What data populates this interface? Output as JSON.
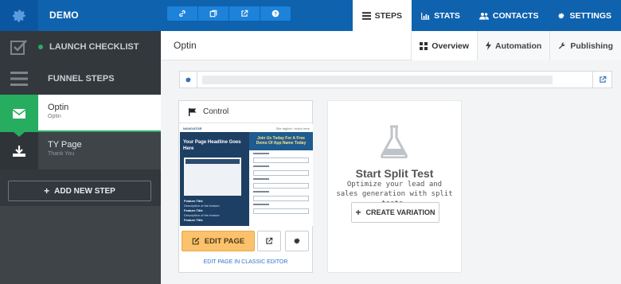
{
  "app": {
    "title": "DEMO"
  },
  "toolbar": {
    "icons": [
      "link-icon",
      "copy-icon",
      "external-link-icon",
      "help-icon"
    ]
  },
  "nav": {
    "tabs": [
      {
        "label": "STEPS",
        "icon": "list-icon",
        "active": true
      },
      {
        "label": "STATS",
        "icon": "bar-chart-icon",
        "active": false
      },
      {
        "label": "CONTACTS",
        "icon": "users-icon",
        "active": false
      },
      {
        "label": "SETTINGS",
        "icon": "gear-icon",
        "active": false
      }
    ]
  },
  "sidebar": {
    "launch_checklist": "LAUNCH CHECKLIST",
    "funnel_steps": "FUNNEL STEPS",
    "steps": [
      {
        "name": "Optin",
        "sub": "Optin",
        "icon": "envelope-icon"
      },
      {
        "name": "TY Page",
        "sub": "Thank You",
        "icon": "download-icon"
      }
    ],
    "add_step": "ADD NEW STEP"
  },
  "main": {
    "page_title": "Optin",
    "subtabs": [
      {
        "label": "Overview",
        "icon": "grid-icon",
        "active": true
      },
      {
        "label": "Automation",
        "icon": "bolt-icon",
        "active": false
      },
      {
        "label": "Publishing",
        "icon": "wrench-icon",
        "active": false
      }
    ],
    "url_value": ""
  },
  "control": {
    "label": "Control",
    "preview": {
      "brand": "NAVIGATOR",
      "top_right": "Site tagline / motto here",
      "headline": "Your Page Headline Goes Here",
      "form_title": "Join Us Today For A Free Demo Of App Name Today",
      "bullets": [
        {
          "title": "Feature Title",
          "desc": "Description of the feature"
        },
        {
          "title": "Feature Title",
          "desc": "Description of the feature"
        },
        {
          "title": "Feature Title",
          "desc": ""
        }
      ]
    },
    "edit_label": "EDIT PAGE",
    "classic_link": "EDIT PAGE IN CLASSIC EDITOR"
  },
  "split_test": {
    "title": "Start Split Test",
    "desc": "Optimize your lead and sales generation with split tests.",
    "button": "CREATE VARIATION"
  },
  "colors": {
    "primary": "#0f62ae",
    "sidebar": "#3f4449",
    "accent_green": "#27ad60",
    "edit_orange": "#fbc26b"
  }
}
